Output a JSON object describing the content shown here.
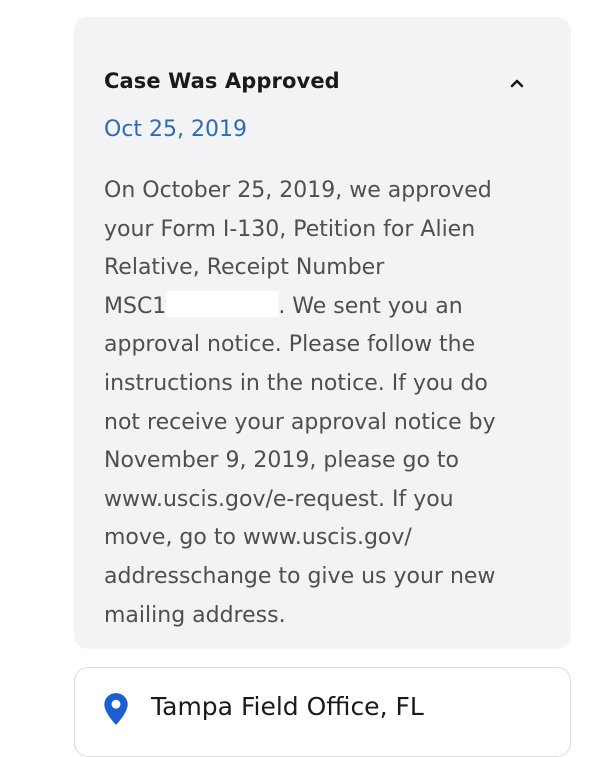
{
  "status_card": {
    "title": "Case Was Approved",
    "date": "Oct 25, 2019",
    "body_lines": [
      "On October 25, 2019, we approved",
      "your Form I-130, Petition for Alien",
      "Relative, Receipt Number",
      "MSC1",
      ".  We sent you an",
      "approval notice.  Please follow the",
      "instructions in the notice. If you do",
      "not receive your approval notice by",
      "November 9, 2019, please go to",
      "www.uscis.gov/e-request.  If you",
      "move, go to www.uscis.gov/",
      "addresschange  to give us your new",
      "mailing address."
    ],
    "collapse_icon": "chevron-up-icon"
  },
  "office": {
    "icon": "location-pin-icon",
    "label": "Tampa Field Office, FL",
    "icon_color": "#1a5fd0"
  },
  "colors": {
    "accent_date": "#2f6ab5",
    "card_background": "#f1f3f5",
    "body_text": "#4f4f4f"
  }
}
